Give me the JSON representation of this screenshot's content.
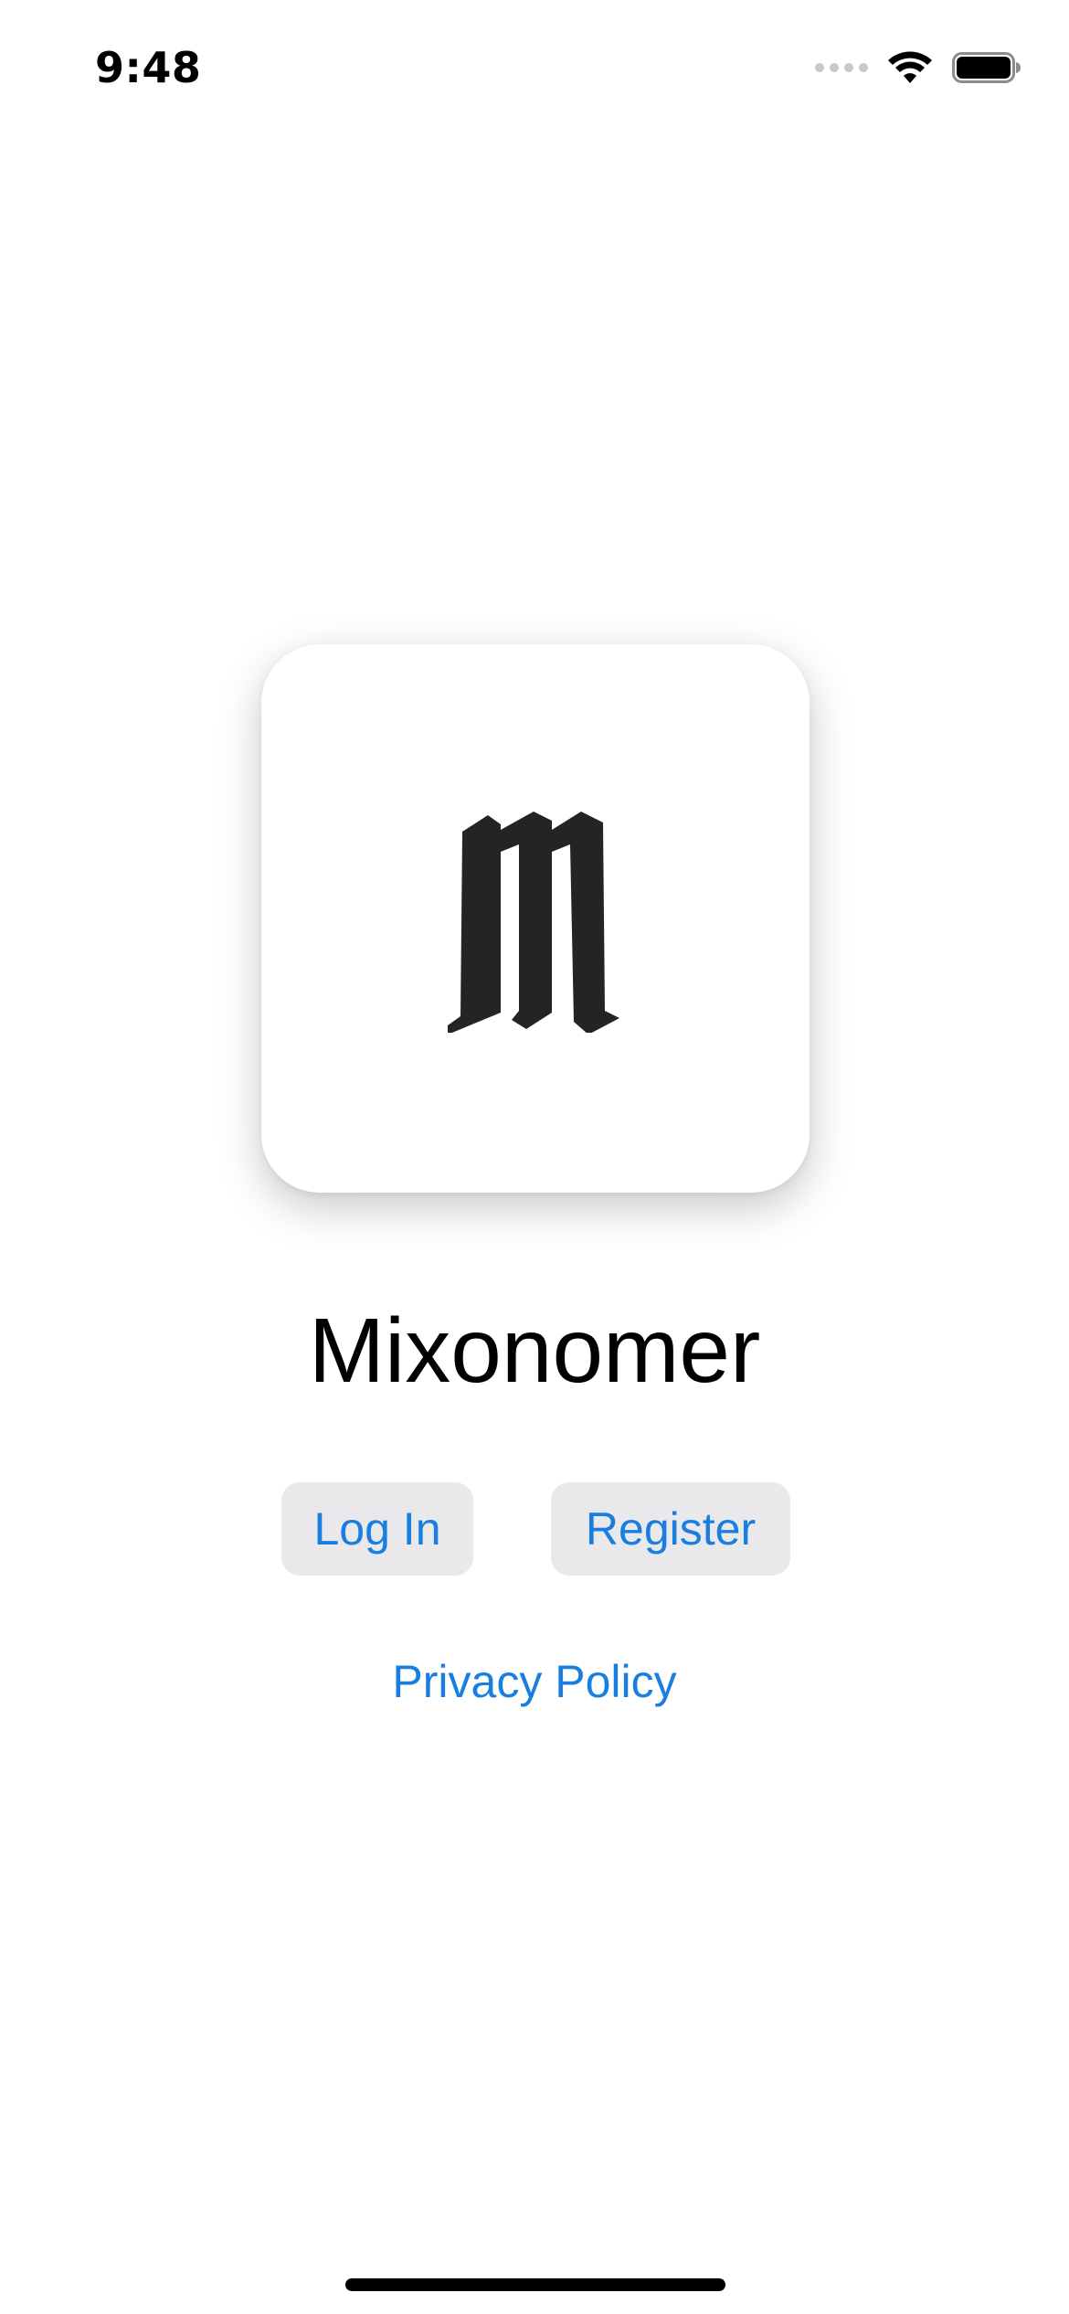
{
  "status_bar": {
    "time": "9:48",
    "signal_icon": "cellular-signal-icon",
    "wifi_icon": "wifi-icon",
    "battery_icon": "battery-icon"
  },
  "app": {
    "logo_glyph": "m",
    "logo_icon": "blackletter-m-logo",
    "title": "Mixonomer"
  },
  "actions": {
    "login_label": "Log In",
    "register_label": "Register",
    "privacy_label": "Privacy Policy"
  },
  "colors": {
    "accent": "#1a7ee0",
    "button_background": "#e9e9eb",
    "logo": "#232426"
  }
}
